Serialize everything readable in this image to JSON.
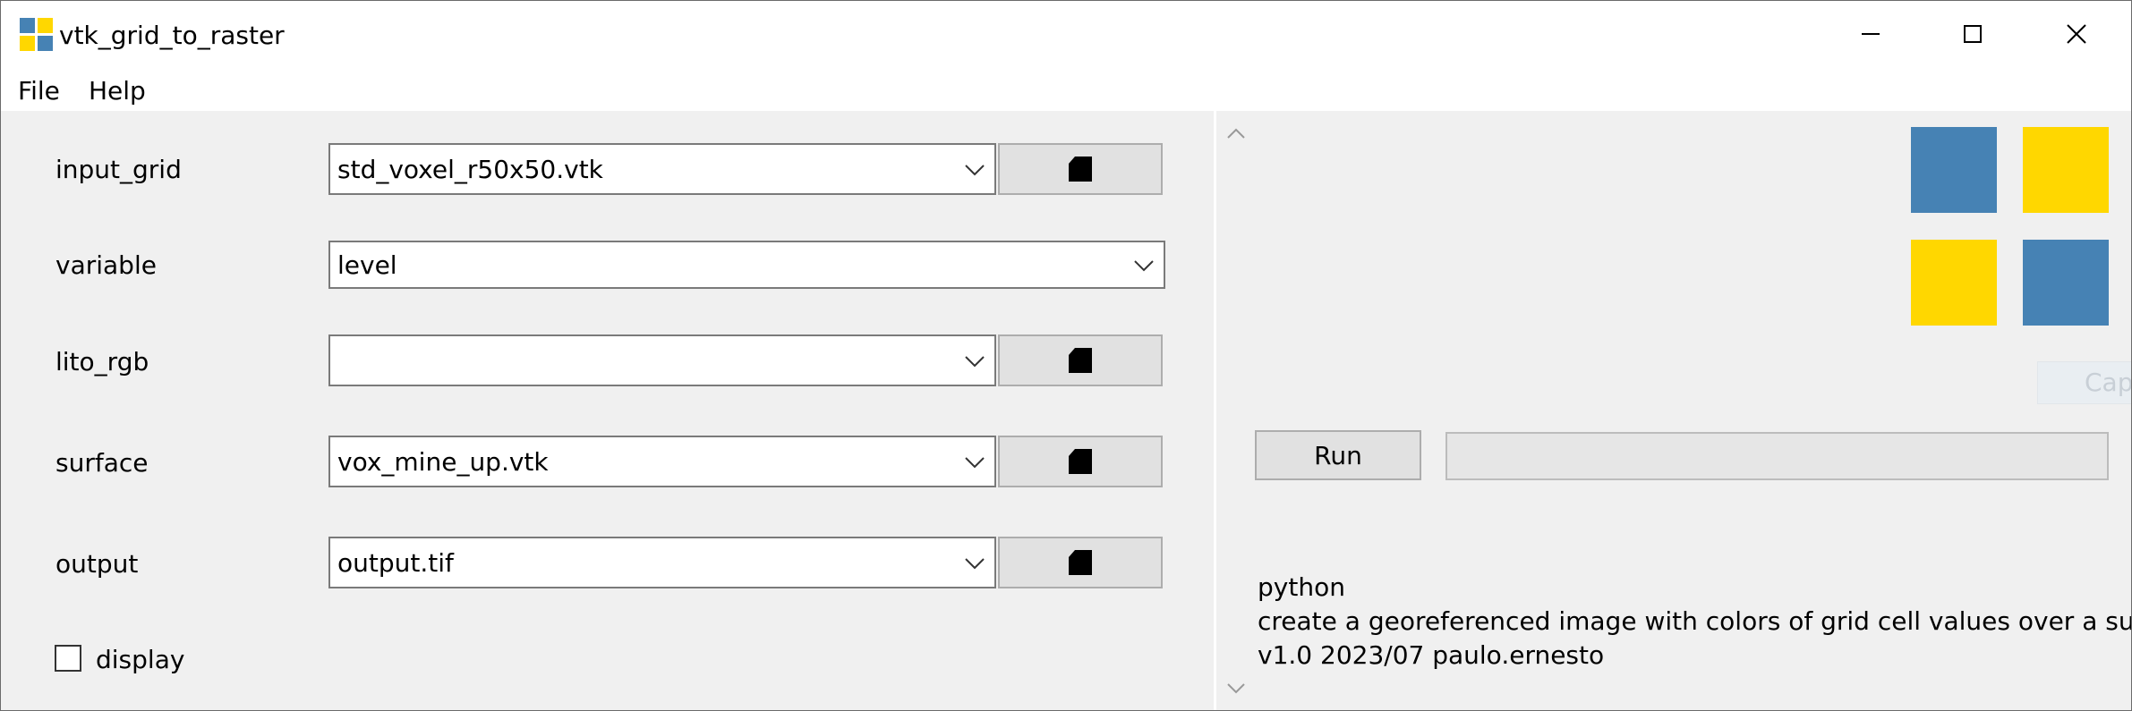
{
  "window": {
    "title": "vtk_grid_to_raster",
    "icon": "app-grid-icon",
    "controls": {
      "minimize": "minimize-icon",
      "maximize": "maximize-icon",
      "close": "close-icon"
    },
    "colors": {
      "blue": "#4682b4",
      "yellow": "#ffd700"
    }
  },
  "menu": {
    "file": "File",
    "help": "Help"
  },
  "form": {
    "fields": [
      {
        "label": "input_grid",
        "value": "std_voxel_r50x50.vtk",
        "has_browse": true
      },
      {
        "label": "variable",
        "value": "level",
        "has_browse": false
      },
      {
        "label": "lito_rgb",
        "value": "",
        "has_browse": true
      },
      {
        "label": "surface",
        "value": "vox_mine_up.vtk",
        "has_browse": true
      },
      {
        "label": "output",
        "value": "output.tif",
        "has_browse": true
      }
    ],
    "browse_icon": "file-browse-icon",
    "display_label": "display",
    "display_checked": false
  },
  "right": {
    "logo_colors": [
      "#4682b4",
      "#ffd700",
      "#ffd700",
      "#4682b4"
    ],
    "ghost_button": "Cap",
    "run_label": "Run",
    "progress": 0,
    "info": [
      "python",
      "create a georeferenced image with colors of grid cell values over a surface",
      "v1.0 2023/07 paulo.ernesto"
    ]
  }
}
